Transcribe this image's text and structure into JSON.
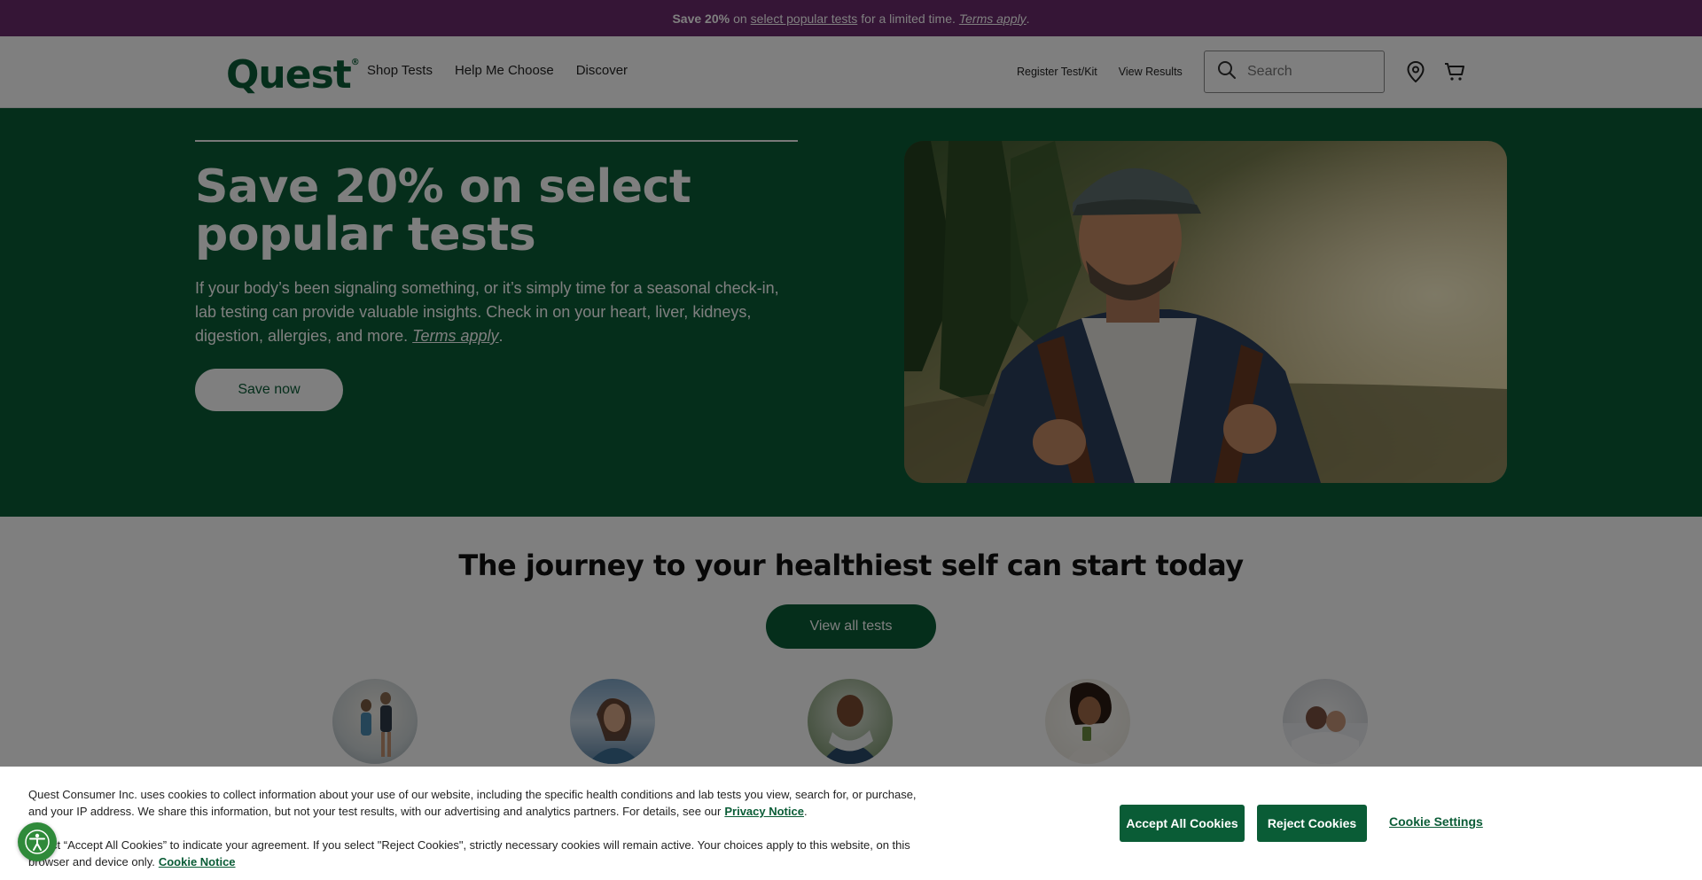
{
  "promo": {
    "bold": "Save 20%",
    "on": "on",
    "link": "select popular tests",
    "middle": "for a limited time.",
    "terms": "Terms apply",
    "period": "."
  },
  "header": {
    "logo": "Quest",
    "nav": [
      "Shop Tests",
      "Help Me Choose",
      "Discover"
    ],
    "register": "Register Test/Kit",
    "results": "View Results",
    "search_placeholder": "Search"
  },
  "hero": {
    "title": "Save 20% on select popular tests",
    "description": "If your body’s been signaling something, or it’s simply time for a seasonal check-in, lab testing can provide valuable insights. Check in on your heart, liver, kidneys, digestion, allergies, and more.",
    "terms": "Terms apply",
    "period": ".",
    "button": "Save now"
  },
  "journey": {
    "heading": "The journey to your healthiest self can start today",
    "button": "View all tests"
  },
  "cookie": {
    "text1": "Quest Consumer Inc. uses cookies to collect information about your use of our website, including the specific health conditions and lab tests you view, search for, or purchase, and your IP address. We share this information, but not your test results, with our advertising and analytics partners. For details, see our",
    "privacy_link": "Privacy Notice",
    "text1_end": ".",
    "text2": "Select “Accept All Cookies” to indicate your agreement. If you select \"Reject Cookies\", strictly necessary cookies will remain active. Your choices apply to this website, on this browser and device only.",
    "cookie_link": "Cookie Notice",
    "accept": "Accept All Cookies",
    "reject": "Reject Cookies",
    "settings": "Cookie Settings"
  },
  "colors": {
    "brand_green": "#0a5c36",
    "promo_purple": "#6a2a6c"
  }
}
